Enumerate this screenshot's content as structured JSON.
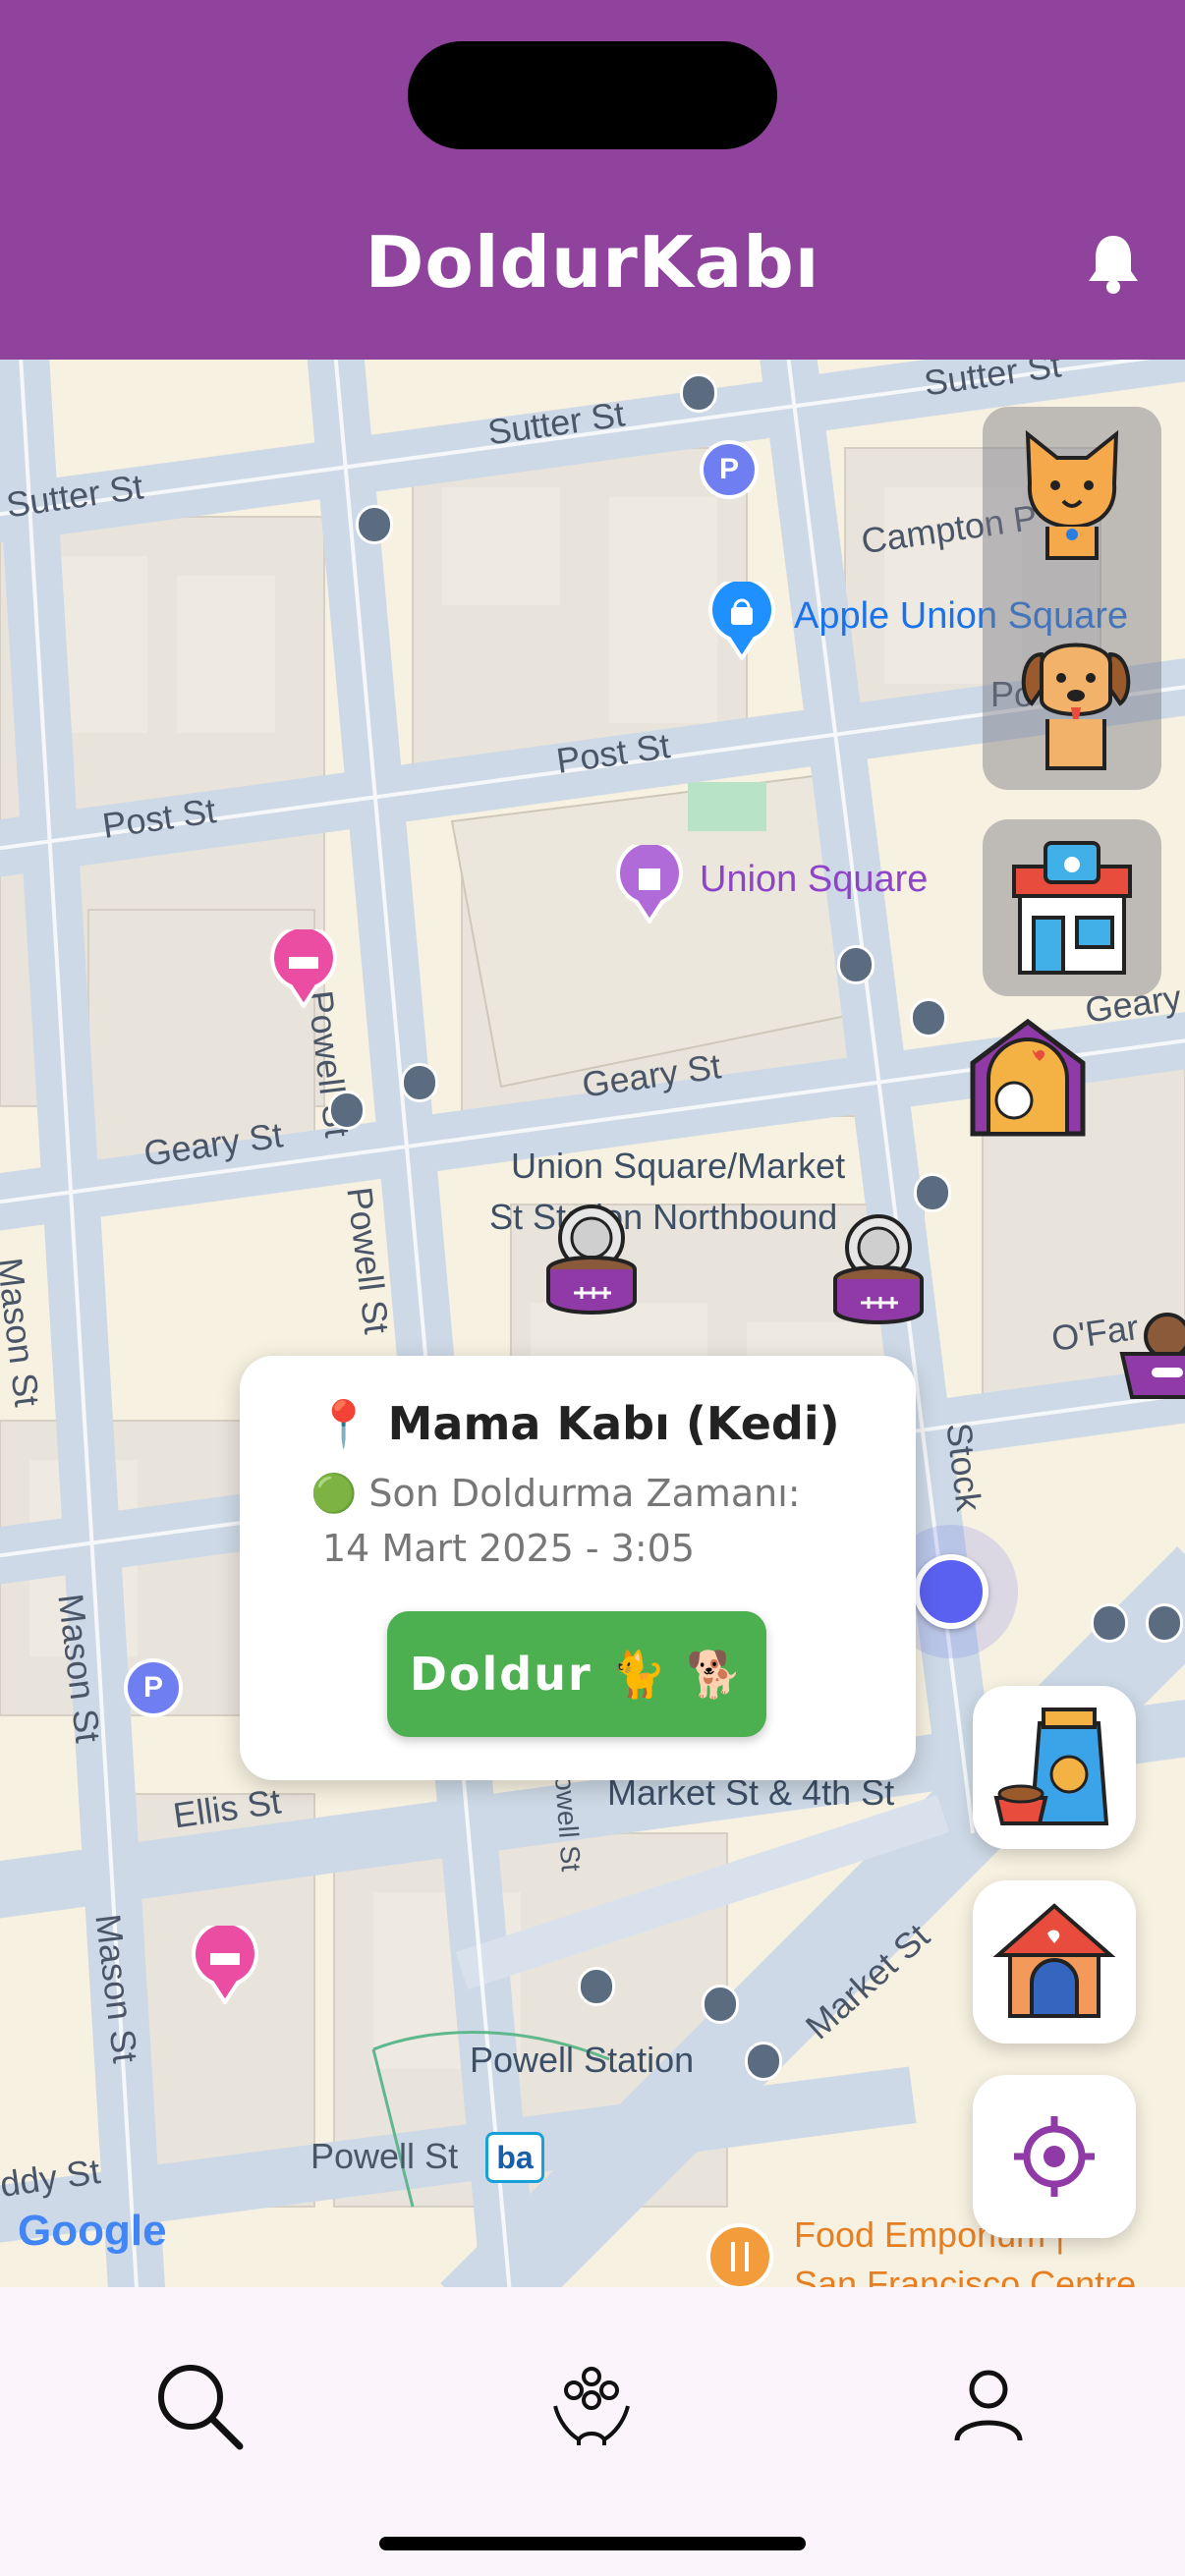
{
  "header": {
    "title": "DoldurKabı",
    "bell_icon": "bell-icon"
  },
  "map": {
    "streets": [
      "Sutter St",
      "Sutter St",
      "Sutter St",
      "Post St",
      "Post St",
      "Geary St",
      "Geary St",
      "Geary St",
      "Powell St",
      "Powell St",
      "Mason St",
      "Mason St",
      "Mason St",
      "Ellis St",
      "Market St",
      "Campton P",
      "Po",
      "Stock",
      "O'Far",
      "ddy St",
      "Powell St",
      "owell St"
    ],
    "pois": {
      "apple": "Apple Union Square",
      "union_square": "Union Square",
      "station_line1": "Union Square/Market",
      "station_line2": "St Station Northbound",
      "market4th": "Market St & 4th St",
      "powell_station": "Powell Station",
      "powell_bart": "Powell St",
      "food_line1": "Food Emporium |",
      "food_line2": "San Francisco Centre"
    },
    "attribution": "Google",
    "parking_label": "P"
  },
  "card": {
    "title": "📍 Mama Kabı (Kedi)",
    "status_line": "🟢 Son Doldurma Zamanı:",
    "timestamp": "14 Mart 2025 - 3:05",
    "fill_button": "Doldur 🐈 🐕"
  },
  "colors": {
    "header": "#8f439d",
    "fill_button": "#4caf50",
    "accent": "#8f3aa6",
    "bottom_nav": "#fcf4fb"
  },
  "bottom_nav": {
    "items": [
      "search-icon",
      "community-icon",
      "profile-icon"
    ]
  }
}
